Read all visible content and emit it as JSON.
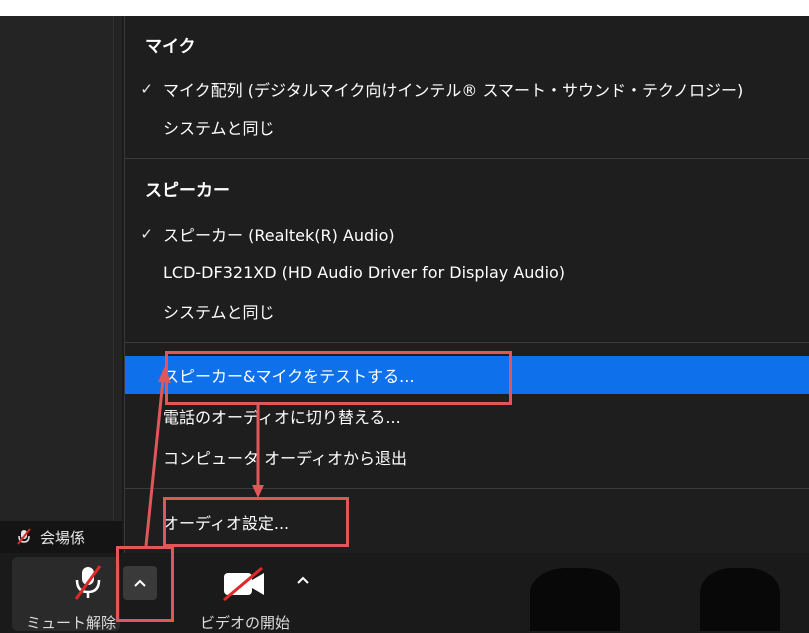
{
  "menu": {
    "mic_header": "マイク",
    "mic_items": [
      {
        "label": "マイク配列 (デジタルマイク向けインテル® スマート・サウンド・テクノロジー)",
        "checked": true
      },
      {
        "label": "システムと同じ",
        "checked": false
      }
    ],
    "speaker_header": "スピーカー",
    "speaker_items": [
      {
        "label": "スピーカー (Realtek(R) Audio)",
        "checked": true
      },
      {
        "label": "LCD-DF321XD (HD Audio Driver for Display Audio)",
        "checked": false
      },
      {
        "label": "システムと同じ",
        "checked": false
      }
    ],
    "actions": [
      {
        "label": "スピーカー&マイクをテストする..."
      },
      {
        "label": "電話のオーディオに切り替える..."
      },
      {
        "label": "コンピュータ オーディオから退出"
      }
    ],
    "audio_settings": "オーディオ設定...",
    "check_glyph": "✓"
  },
  "participant": {
    "name": "会場係"
  },
  "toolbar": {
    "unmute_label": "ミュート解除",
    "video_label": "ビデオの開始",
    "caret_glyph": "^"
  },
  "colors": {
    "highlight": "#0e71eb",
    "annotation": "#e0575a",
    "menu_bg": "#1e1e1e",
    "mute_red": "#e02828"
  },
  "icons": [
    "check-icon",
    "microphone-muted-icon",
    "video-muted-icon",
    "chevron-up-icon"
  ]
}
